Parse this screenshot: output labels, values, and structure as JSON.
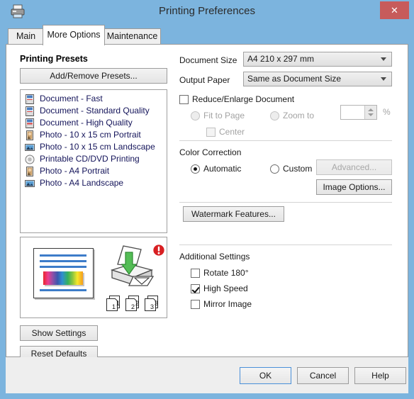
{
  "window": {
    "title": "Printing Preferences",
    "printer_icon": "printer-icon",
    "close_label": "✕",
    "titlebar_color": "#7cb4de",
    "close_color": "#c75b5b"
  },
  "tabs": [
    {
      "label": "Main",
      "active": false
    },
    {
      "label": "More Options",
      "active": true
    },
    {
      "label": "Maintenance",
      "active": false
    }
  ],
  "left": {
    "presets_heading": "Printing Presets",
    "add_remove_label": "Add/Remove Presets...",
    "presets": [
      {
        "label": "Document - Fast",
        "icon": "document-icon"
      },
      {
        "label": "Document - Standard Quality",
        "icon": "document-icon"
      },
      {
        "label": "Document - High Quality",
        "icon": "document-high-icon"
      },
      {
        "label": "Photo - 10 x 15 cm Portrait",
        "icon": "photo-portrait-icon"
      },
      {
        "label": "Photo - 10 x 15 cm Landscape",
        "icon": "photo-landscape-icon"
      },
      {
        "label": "Printable CD/DVD Printing",
        "icon": "cd-dvd-icon"
      },
      {
        "label": "Photo - A4 Portrait",
        "icon": "photo-portrait-icon"
      },
      {
        "label": "Photo - A4 Landscape",
        "icon": "photo-landscape-icon"
      }
    ],
    "preview": {
      "document_thumb": "document-preview",
      "printer_illustration": "printer-illustration",
      "warning_badge": "warning-icon",
      "page_numbers": [
        "1",
        "2",
        "3"
      ]
    },
    "show_settings_label": "Show Settings",
    "reset_defaults_label": "Reset Defaults"
  },
  "right": {
    "document_size_label": "Document Size",
    "document_size_value": "A4 210 x 297 mm",
    "output_paper_label": "Output Paper",
    "output_paper_value": "Same as Document Size",
    "reduce_enlarge_label": "Reduce/Enlarge Document",
    "reduce_enlarge_checked": false,
    "fit_to_page_label": "Fit to Page",
    "fit_to_page_selected": false,
    "zoom_to_label": "Zoom to",
    "zoom_to_selected": false,
    "zoom_value": "",
    "percent_label": "%",
    "center_label": "Center",
    "center_checked": false,
    "color_correction_label": "Color Correction",
    "automatic_label": "Automatic",
    "automatic_selected": true,
    "custom_label": "Custom",
    "custom_selected": false,
    "advanced_label": "Advanced...",
    "advanced_enabled": false,
    "image_options_label": "Image Options...",
    "watermark_label": "Watermark Features...",
    "additional_settings_label": "Additional Settings",
    "rotate_180_label": "Rotate 180°",
    "rotate_180_checked": false,
    "high_speed_label": "High Speed",
    "high_speed_checked": true,
    "mirror_image_label": "Mirror Image",
    "mirror_image_checked": false
  },
  "footer": {
    "ok_label": "OK",
    "cancel_label": "Cancel",
    "help_label": "Help"
  }
}
